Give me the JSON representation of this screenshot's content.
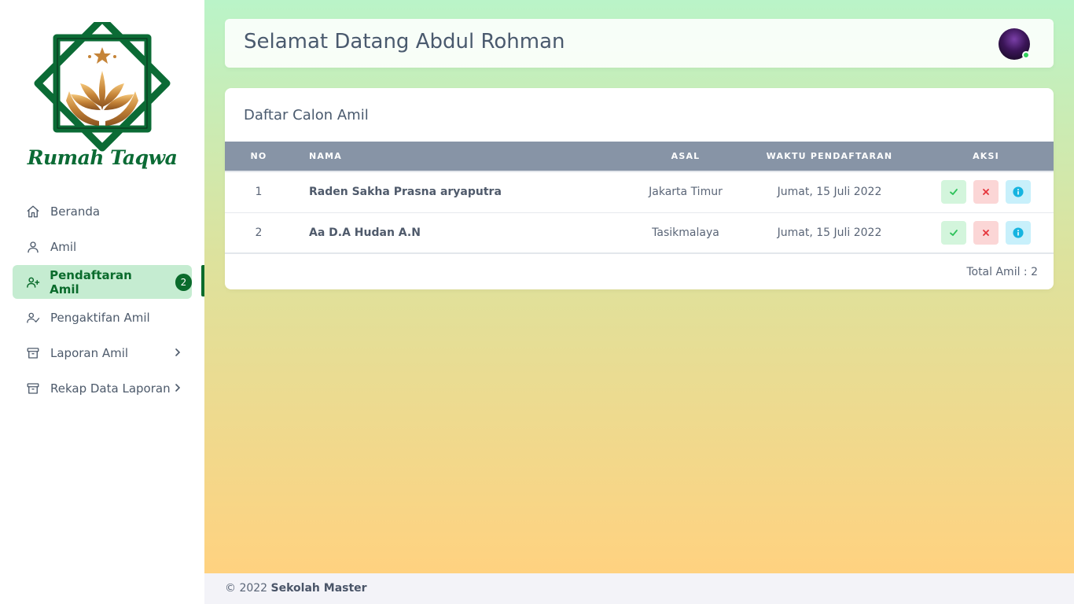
{
  "brand": {
    "name": "Rumah Taqwa",
    "color": "#0b6b35"
  },
  "sidebar": {
    "items": [
      {
        "label": "Beranda",
        "icon": "home-icon"
      },
      {
        "label": "Amil",
        "icon": "user-icon"
      },
      {
        "label": "Pendaftaran Amil",
        "icon": "user-plus-icon",
        "badge": "2",
        "active": true
      },
      {
        "label": "Pengaktifan Amil",
        "icon": "user-check-icon"
      },
      {
        "label": "Laporan Amil",
        "icon": "archive-icon",
        "has_submenu": true
      },
      {
        "label": "Rekap Data Laporan",
        "icon": "archive-icon",
        "has_submenu": true
      }
    ]
  },
  "header": {
    "greeting": "Selamat Datang Abdul Rohman"
  },
  "table_card": {
    "title": "Daftar Calon Amil",
    "columns": [
      "NO",
      "NAMA",
      "ASAL",
      "WAKTU PENDAFTARAN",
      "AKSI"
    ],
    "rows": [
      {
        "no": "1",
        "nama": "Raden Sakha Prasna aryaputra",
        "asal": "Jakarta Timur",
        "waktu": "Jumat, 15 Juli 2022"
      },
      {
        "no": "2",
        "nama": "Aa D.A Hudan A.N",
        "asal": "Tasikmalaya",
        "waktu": "Jumat, 15 Juli 2022"
      }
    ],
    "total": "Total Amil : 2"
  },
  "footer": {
    "copyright": "© 2022",
    "owner": "Sekolah Master"
  },
  "colors": {
    "accent": "#0a6b2c",
    "active_bg": "#c5ecd1",
    "approve": "#2fc25b",
    "reject": "#e5343b",
    "info": "#16b4e0"
  }
}
